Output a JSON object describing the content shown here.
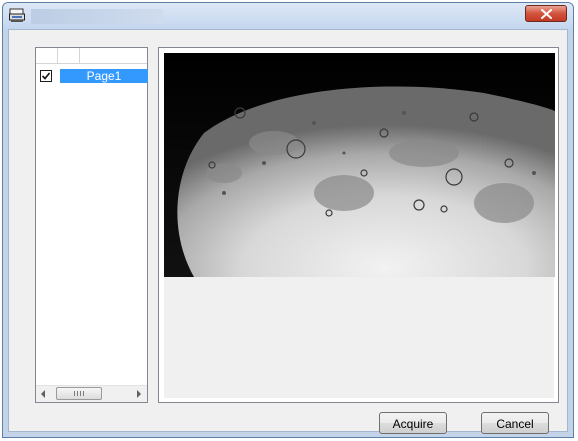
{
  "window": {
    "title": ""
  },
  "icons": {
    "app_icon": "scanner-icon",
    "close": "close-icon",
    "check": "checkmark-icon",
    "scroll_left": "scroll-left-arrow",
    "scroll_right": "scroll-right-arrow"
  },
  "pages_list": {
    "items": [
      {
        "label": "Page1",
        "checked": true,
        "selected": true
      }
    ]
  },
  "preview": {
    "content": "moon surface scan image"
  },
  "buttons": {
    "acquire_label": "Acquire",
    "cancel_label": "Cancel"
  },
  "colors": {
    "selection": "#3399ff",
    "close_button": "#c23a24",
    "titlebar": "#c4d6ee"
  }
}
